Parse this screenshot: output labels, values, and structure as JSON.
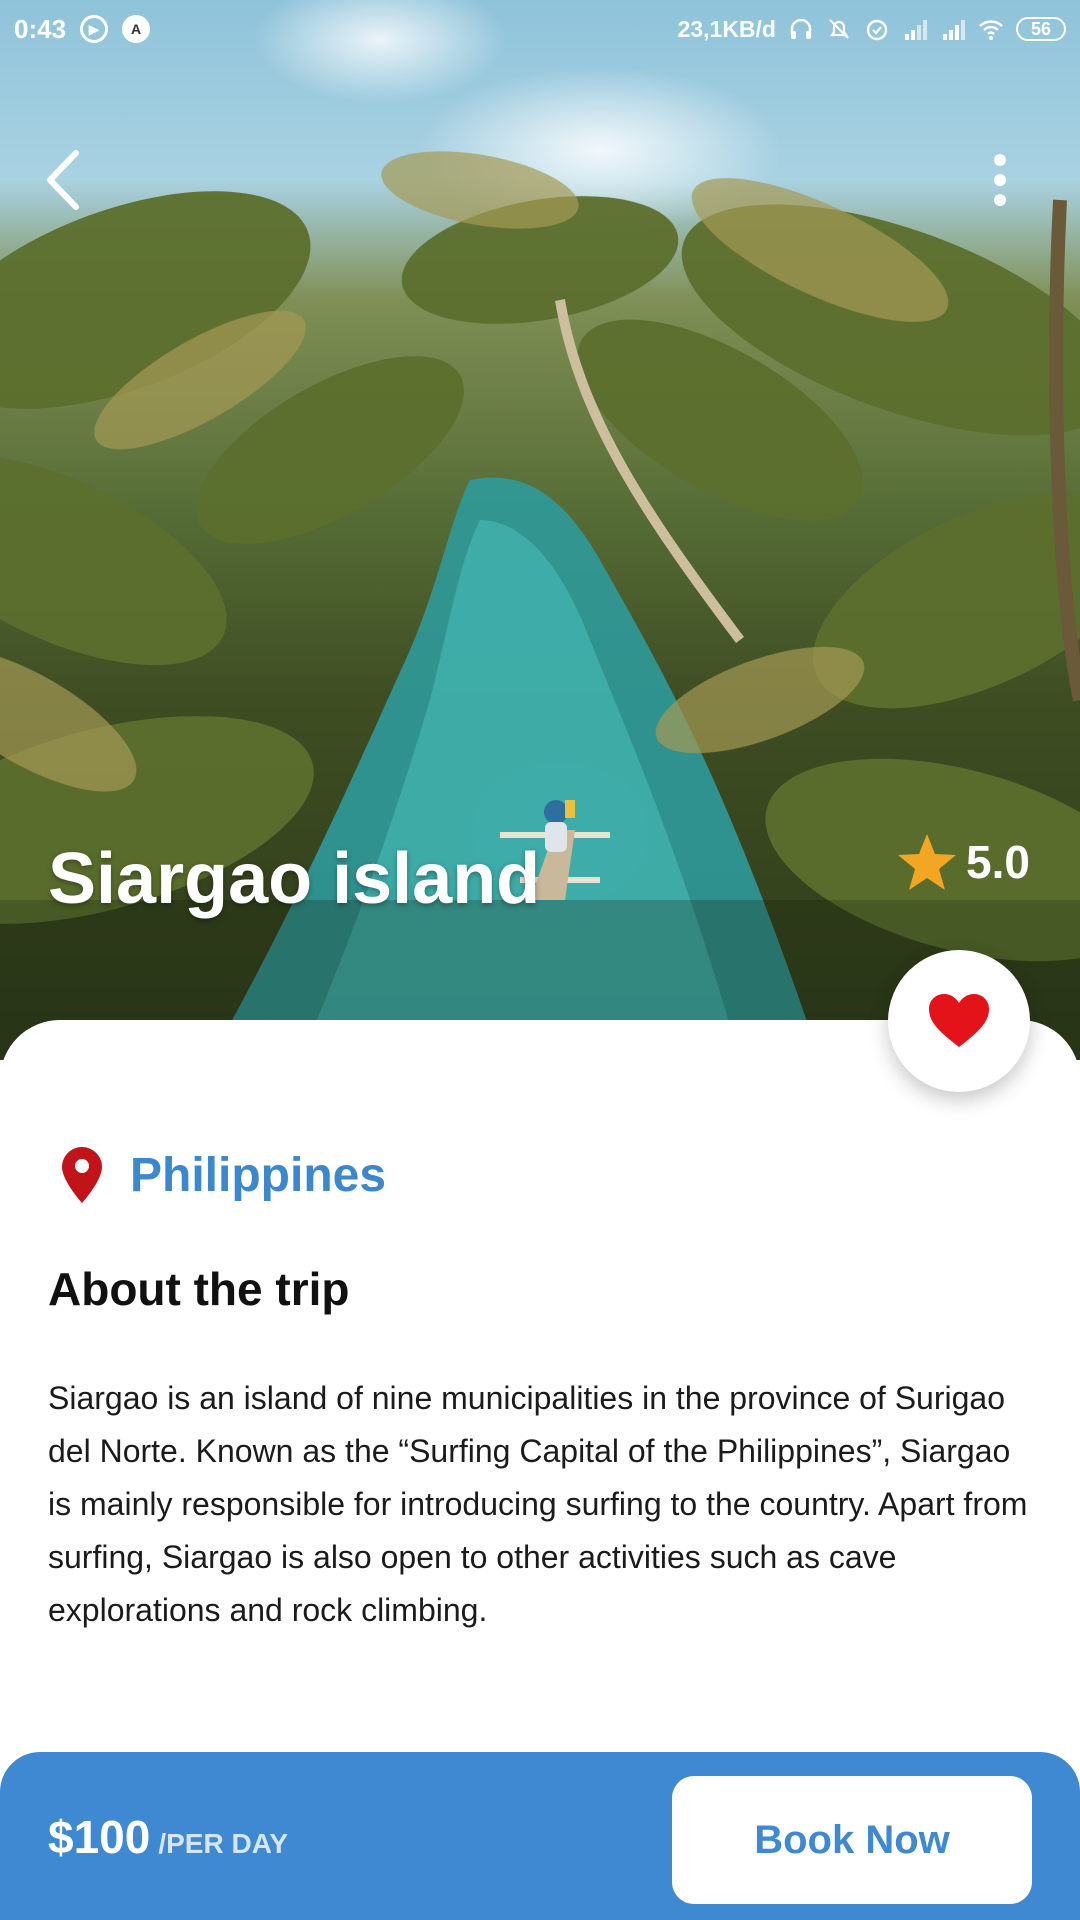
{
  "status_bar": {
    "time": "0:43",
    "speed": "23,1KB/d",
    "battery": "56"
  },
  "header": {
    "back_icon": "chevron-left-icon",
    "more_icon": "more-vertical-icon"
  },
  "hero": {
    "title": "Siargao island",
    "rating": "5.0",
    "rating_icon": "star-icon"
  },
  "favorite": {
    "icon": "heart-icon",
    "color": "#e4131a"
  },
  "location": {
    "icon": "map-pin-icon",
    "name": "Philippines"
  },
  "about": {
    "title": "About the trip",
    "text": "Siargao is an island of nine municipalities in the province of Surigao del Norte. Known as the “Surfing Capital of the Philippines”, Siargao is mainly responsible for introducing surfing to the country. Apart from surfing, Siargao is also open to other activities such as cave explorations and rock climbing."
  },
  "booking": {
    "price": "$100",
    "unit": "/PER DAY",
    "button_label": "Book Now"
  },
  "colors": {
    "accent": "#3e89d2",
    "star": "#f2a623",
    "pin": "#c0141a"
  }
}
